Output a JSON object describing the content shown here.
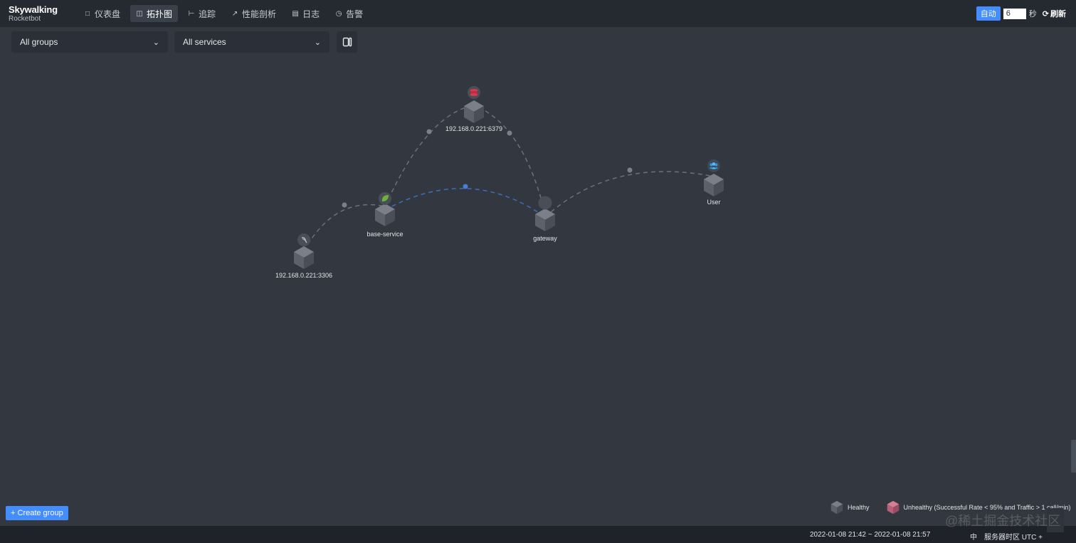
{
  "app": {
    "brand": "Skywalking",
    "subtitle": "Rocketbot"
  },
  "nav": [
    {
      "label": "仪表盘",
      "icon": "dashboard-icon",
      "active": false
    },
    {
      "label": "拓扑图",
      "icon": "topology-icon",
      "active": true
    },
    {
      "label": "追踪",
      "icon": "trace-icon",
      "active": false
    },
    {
      "label": "性能剖析",
      "icon": "profile-icon",
      "active": false
    },
    {
      "label": "日志",
      "icon": "log-icon",
      "active": false
    },
    {
      "label": "告警",
      "icon": "alarm-icon",
      "active": false
    }
  ],
  "refresh_controls": {
    "auto_label": "自动",
    "interval_value": "6",
    "seconds_label": "秒",
    "refresh_label": "刷新"
  },
  "filters": {
    "group_select": "All groups",
    "service_select": "All services"
  },
  "topology": {
    "nodes": [
      {
        "label": "192.168.0.221:6379",
        "type": "redis",
        "health": "Healthy"
      },
      {
        "label": "User",
        "type": "user",
        "health": "Healthy"
      },
      {
        "label": "base-service",
        "type": "spring",
        "health": "Healthy"
      },
      {
        "label": "gateway",
        "type": "unknown",
        "health": "Healthy"
      },
      {
        "label": "192.168.0.221:3306",
        "type": "mysql",
        "health": "Healthy"
      }
    ],
    "edges": [
      {
        "from": "base-service",
        "to": "192.168.0.221:6379"
      },
      {
        "from": "gateway",
        "to": "192.168.0.221:6379"
      },
      {
        "from": "base-service",
        "to": "gateway"
      },
      {
        "from": "gateway",
        "to": "User"
      },
      {
        "from": "192.168.0.221:3306",
        "to": "base-service"
      }
    ]
  },
  "create_group_label": "+ Create group",
  "legend": {
    "healthy": "Healthy",
    "unhealthy": "Unhealthy (Successful Rate < 95% and Traffic > 1 call/min)"
  },
  "footer": {
    "time_range": "2022-01-08 21:42 ~ 2022-01-08 21:57",
    "lang": "中",
    "timezone": "服务器时区 UTC +"
  },
  "watermark": "@稀土掘金技术社区",
  "colors": {
    "accent": "#448dfe",
    "background": "#333840",
    "healthy_node": "#5a5f68",
    "unhealthy_node": "#c0607a",
    "redis": "#d8394f",
    "spring": "#6bb33e",
    "user": "#2f9ae0"
  }
}
